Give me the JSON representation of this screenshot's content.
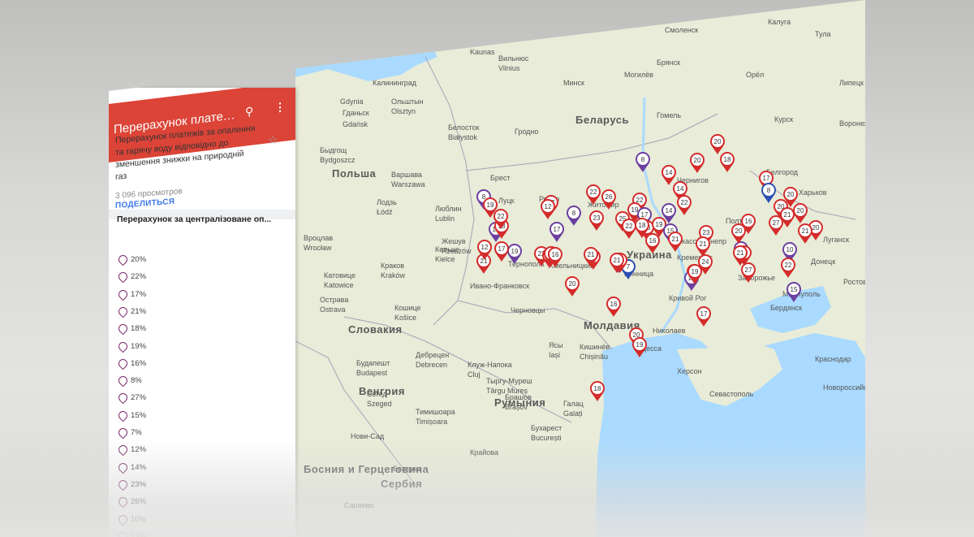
{
  "panel": {
    "title": "Перерахунок платежі...",
    "description": "Перерахунок платежів за опалення та гарячу воду відповідно до зменшення знижки на природній газ",
    "views": "3 096 просмотров",
    "share_label": "ПОДЕЛИТЬСЯ",
    "layer_title": "Перерахунок за централізоване оп...",
    "legend": [
      "20%",
      "22%",
      "17%",
      "21%",
      "18%",
      "19%",
      "16%",
      "8%",
      "27%",
      "15%",
      "7%",
      "12%",
      "14%",
      "23%",
      "26%",
      "10%",
      "13%"
    ]
  },
  "icons": {
    "search": "search-icon",
    "more": "more-vert-icon",
    "star": "star-icon"
  },
  "colors": {
    "header": "#db4437",
    "pin_red": "#d42b2b",
    "pin_purple": "#6b3fa0",
    "pin_blue": "#2b4fb3",
    "map_land": "#e8ecd8",
    "map_sea": "#aadaff"
  },
  "map": {
    "countries": [
      {
        "name": "Польша"
      },
      {
        "name": "Беларусь"
      },
      {
        "name": "Украина"
      },
      {
        "name": "Словакия"
      },
      {
        "name": "Венгрия"
      },
      {
        "name": "Румыния"
      },
      {
        "name": "Молдавия"
      },
      {
        "name": "Сербия"
      },
      {
        "name": "Босния и Герцеговина"
      }
    ],
    "cities": [
      {
        "name": "Калининград"
      },
      {
        "name": "Gdynia"
      },
      {
        "name": "Гданьск"
      },
      {
        "name": "Gdańsk"
      },
      {
        "name": "Ольштын"
      },
      {
        "name": "Olsztyn"
      },
      {
        "name": "Быдгощ"
      },
      {
        "name": "Bydgoszcz"
      },
      {
        "name": "Варшава"
      },
      {
        "name": "Warszawa"
      },
      {
        "name": "Лодзь"
      },
      {
        "name": "Łódź"
      },
      {
        "name": "Вроцлав"
      },
      {
        "name": "Wrocław"
      },
      {
        "name": "Краков"
      },
      {
        "name": "Kraków"
      },
      {
        "name": "Катовице"
      },
      {
        "name": "Katowice"
      },
      {
        "name": "Острава"
      },
      {
        "name": "Ostrava"
      },
      {
        "name": "Кошице"
      },
      {
        "name": "Košice"
      },
      {
        "name": "Будапешт"
      },
      {
        "name": "Budapest"
      },
      {
        "name": "Сегед"
      },
      {
        "name": "Szeged"
      },
      {
        "name": "Дебрецен"
      },
      {
        "name": "Debrecen"
      },
      {
        "name": "Тимишоара"
      },
      {
        "name": "Timișoara"
      },
      {
        "name": "Нови-Сад"
      },
      {
        "name": "Белград"
      },
      {
        "name": "Сараево"
      },
      {
        "name": "Крайова"
      },
      {
        "name": "Бухарест"
      },
      {
        "name": "București"
      },
      {
        "name": "Клуж-Напока"
      },
      {
        "name": "Cluj"
      },
      {
        "name": "Тыргу-Муреш"
      },
      {
        "name": "Târgu Mureș"
      },
      {
        "name": "Брашов"
      },
      {
        "name": "Brașov"
      },
      {
        "name": "Галац"
      },
      {
        "name": "Galați"
      },
      {
        "name": "Ясы"
      },
      {
        "name": "Iași"
      },
      {
        "name": "Кишинёв"
      },
      {
        "name": "Chișinău"
      },
      {
        "name": "Черновцы"
      },
      {
        "name": "Ивано-Франковск"
      },
      {
        "name": "Тернополь"
      },
      {
        "name": "Хмельницкий"
      },
      {
        "name": "Житомир"
      },
      {
        "name": "Ровно"
      },
      {
        "name": "Луцк"
      },
      {
        "name": "Брест"
      },
      {
        "name": "Люблин"
      },
      {
        "name": "Lublin"
      },
      {
        "name": "Жешув"
      },
      {
        "name": "Rzeszów"
      },
      {
        "name": "Кельце"
      },
      {
        "name": "Kielce"
      },
      {
        "name": "Белосток"
      },
      {
        "name": "Białystok"
      },
      {
        "name": "Гродно"
      },
      {
        "name": "Вильнюс"
      },
      {
        "name": "Vilnius"
      },
      {
        "name": "Каунас"
      },
      {
        "name": "Kaunas"
      },
      {
        "name": "Минск"
      },
      {
        "name": "Могилёв"
      },
      {
        "name": "Гомель"
      },
      {
        "name": "Смоленск"
      },
      {
        "name": "Брянск"
      },
      {
        "name": "Калуга"
      },
      {
        "name": "Тула"
      },
      {
        "name": "Орёл"
      },
      {
        "name": "Липецк"
      },
      {
        "name": "Курск"
      },
      {
        "name": "Воронеж"
      },
      {
        "name": "Белгород"
      },
      {
        "name": "Харьков"
      },
      {
        "name": "Полтава"
      },
      {
        "name": "Днепр"
      },
      {
        "name": "Запорожье"
      },
      {
        "name": "Кривой Рог"
      },
      {
        "name": "Николаев"
      },
      {
        "name": "Одесса"
      },
      {
        "name": "Херсон"
      },
      {
        "name": "Мариуполь"
      },
      {
        "name": "Бердянск"
      },
      {
        "name": "Донецк"
      },
      {
        "name": "Луганск"
      },
      {
        "name": "Ростов-на-Дону"
      },
      {
        "name": "Краснодар"
      },
      {
        "name": "Новороссийск"
      },
      {
        "name": "Севастополь"
      },
      {
        "name": "Кременчуг"
      },
      {
        "name": "Черкассы"
      },
      {
        "name": "Винница"
      },
      {
        "name": "Чернигов"
      }
    ],
    "pins": [
      {
        "label": "20",
        "color": "red"
      },
      {
        "label": "8",
        "color": "purple"
      },
      {
        "label": "20",
        "color": "red"
      },
      {
        "label": "18",
        "color": "red"
      },
      {
        "label": "14",
        "color": "red"
      },
      {
        "label": "14",
        "color": "red"
      },
      {
        "label": "22",
        "color": "red"
      },
      {
        "label": "17",
        "color": "red"
      },
      {
        "label": "8",
        "color": "blue"
      },
      {
        "label": "22",
        "color": "red"
      },
      {
        "label": "26",
        "color": "red"
      },
      {
        "label": "22",
        "color": "red"
      },
      {
        "label": "19",
        "color": "red"
      },
      {
        "label": "20",
        "color": "red"
      },
      {
        "label": "20",
        "color": "red"
      },
      {
        "label": "17",
        "color": "purple"
      },
      {
        "label": "20",
        "color": "red"
      },
      {
        "label": "27",
        "color": "red"
      },
      {
        "label": "16",
        "color": "red"
      },
      {
        "label": "20",
        "color": "red"
      },
      {
        "label": "17",
        "color": "red"
      },
      {
        "label": "23",
        "color": "red"
      },
      {
        "label": "25",
        "color": "red"
      },
      {
        "label": "18",
        "color": "red"
      },
      {
        "label": "19",
        "color": "red"
      },
      {
        "label": "14",
        "color": "purple"
      },
      {
        "label": "12",
        "color": "red"
      },
      {
        "label": "8",
        "color": "purple"
      },
      {
        "label": "22",
        "color": "red"
      },
      {
        "label": "12",
        "color": "purple"
      },
      {
        "label": "17",
        "color": "purple"
      },
      {
        "label": "21",
        "color": "red"
      },
      {
        "label": "27",
        "color": "red"
      },
      {
        "label": "16",
        "color": "purple"
      },
      {
        "label": "8",
        "color": "purple"
      },
      {
        "label": "19",
        "color": "red"
      },
      {
        "label": "18",
        "color": "red"
      },
      {
        "label": "15",
        "color": "purple"
      },
      {
        "label": "7",
        "color": "blue"
      },
      {
        "label": "12",
        "color": "red"
      },
      {
        "label": "22",
        "color": "red"
      },
      {
        "label": "21",
        "color": "red"
      },
      {
        "label": "27",
        "color": "red"
      },
      {
        "label": "25",
        "color": "red"
      },
      {
        "label": "23",
        "color": "red"
      },
      {
        "label": "16",
        "color": "red"
      },
      {
        "label": "21",
        "color": "red"
      },
      {
        "label": "21",
        "color": "red"
      },
      {
        "label": "7",
        "color": "purple"
      },
      {
        "label": "22",
        "color": "red"
      },
      {
        "label": "24",
        "color": "red"
      },
      {
        "label": "21",
        "color": "red"
      },
      {
        "label": "22",
        "color": "red"
      },
      {
        "label": "10",
        "color": "purple"
      },
      {
        "label": "22",
        "color": "red"
      },
      {
        "label": "15",
        "color": "purple"
      },
      {
        "label": "17",
        "color": "purple"
      },
      {
        "label": "19",
        "color": "red"
      },
      {
        "label": "20",
        "color": "red"
      },
      {
        "label": "21",
        "color": "red"
      },
      {
        "label": "21",
        "color": "red"
      },
      {
        "label": "16",
        "color": "red"
      },
      {
        "label": "27",
        "color": "red"
      },
      {
        "label": "19",
        "color": "purple"
      },
      {
        "label": "17",
        "color": "red"
      },
      {
        "label": "22",
        "color": "red"
      },
      {
        "label": "16",
        "color": "red"
      },
      {
        "label": "21",
        "color": "red"
      },
      {
        "label": "20",
        "color": "red"
      },
      {
        "label": "19",
        "color": "red"
      },
      {
        "label": "18",
        "color": "red"
      },
      {
        "label": "22",
        "color": "red"
      },
      {
        "label": "20",
        "color": "red"
      },
      {
        "label": "16",
        "color": "red"
      },
      {
        "label": "17",
        "color": "red"
      }
    ]
  }
}
